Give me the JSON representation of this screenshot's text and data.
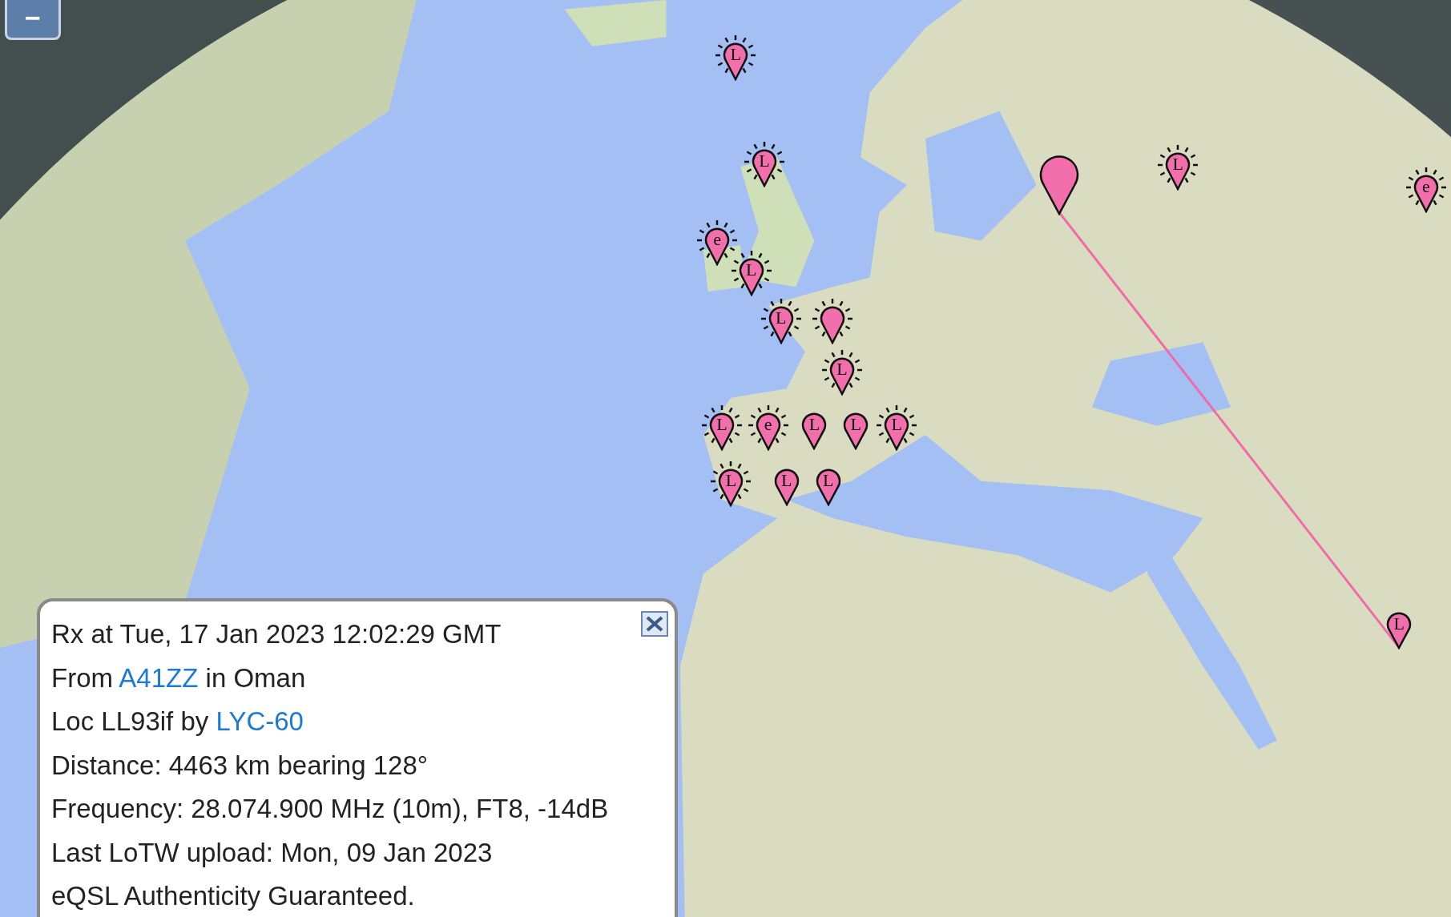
{
  "map": {
    "zoom_out": "−",
    "markers": [
      {
        "label": "L",
        "kind": "beacon"
      },
      {
        "label": "L",
        "kind": "beacon"
      },
      {
        "kind": "big"
      },
      {
        "label": "L",
        "kind": "beacon"
      },
      {
        "label": "e",
        "kind": "beacon"
      },
      {
        "label": "e",
        "kind": "beacon"
      },
      {
        "label": "L",
        "kind": "beacon"
      },
      {
        "label": "L",
        "kind": "beacon"
      },
      {
        "kind": "beacon"
      },
      {
        "label": "L",
        "kind": "beacon"
      },
      {
        "label": "L",
        "kind": "beacon"
      },
      {
        "label": "e",
        "kind": "beacon"
      },
      {
        "label": "L",
        "kind": "plain"
      },
      {
        "label": "L",
        "kind": "plain"
      },
      {
        "label": "L",
        "kind": "beacon"
      },
      {
        "label": "L",
        "kind": "beacon"
      },
      {
        "label": "L",
        "kind": "plain"
      },
      {
        "label": "L",
        "kind": "plain"
      },
      {
        "label": "L",
        "kind": "plain"
      }
    ]
  },
  "popup": {
    "lines": [
      {
        "text": "Rx at Tue, 17 Jan 2023 12:02:29 GMT"
      },
      {
        "text": "From ",
        "link": "A41ZZ",
        "after": " in Oman"
      },
      {
        "text": "Loc LL93if by ",
        "link": "LYC-60"
      },
      {
        "text": "Distance: 4463 km bearing 128°"
      },
      {
        "text": "Frequency: 28.074.900 MHz (10m), FT8, -14dB"
      },
      {
        "text": "Last LoTW upload: Mon, 09 Jan 2023"
      },
      {
        "text": "eQSL Authenticity Guaranteed."
      }
    ]
  }
}
